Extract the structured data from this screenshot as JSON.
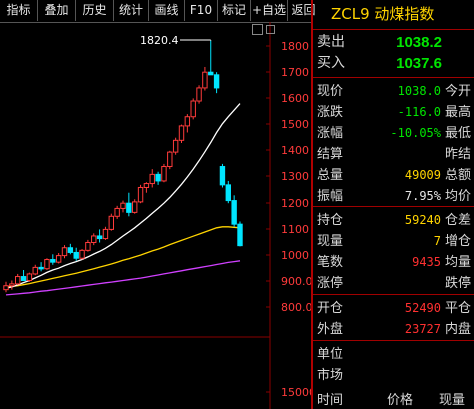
{
  "toolbar": {
    "items": [
      "指标",
      "叠加",
      "历史",
      "统计",
      "画线",
      "F10",
      "标记",
      "+自选",
      "返回"
    ]
  },
  "chart": {
    "peak_label": "1820.4",
    "y_ticks": [
      "1800",
      "1700",
      "1600",
      "1500",
      "1400",
      "1300",
      "1200",
      "1100",
      "1000",
      "900.0",
      "800.0",
      "15000"
    ],
    "colors": {
      "up": "#ff3b3b",
      "down": "#00e5ff",
      "ma_short": "#ffffff",
      "ma_mid": "#ffd400",
      "ma_long": "#d040ff",
      "axis_text": "#ff3b3b"
    },
    "candles": [
      [
        870,
        900,
        860,
        885
      ],
      [
        885,
        905,
        870,
        892
      ],
      [
        892,
        930,
        888,
        920
      ],
      [
        920,
        945,
        910,
        905
      ],
      [
        905,
        935,
        900,
        930
      ],
      [
        930,
        965,
        925,
        955
      ],
      [
        955,
        975,
        940,
        950
      ],
      [
        950,
        990,
        945,
        985
      ],
      [
        985,
        1005,
        965,
        975
      ],
      [
        975,
        1010,
        970,
        1000
      ],
      [
        1000,
        1040,
        990,
        1030
      ],
      [
        1030,
        1045,
        1005,
        1012
      ],
      [
        1012,
        1030,
        980,
        990
      ],
      [
        990,
        1025,
        985,
        1020
      ],
      [
        1020,
        1060,
        1015,
        1050
      ],
      [
        1050,
        1085,
        1040,
        1075
      ],
      [
        1075,
        1100,
        1050,
        1065
      ],
      [
        1065,
        1110,
        1060,
        1100
      ],
      [
        1100,
        1160,
        1095,
        1150
      ],
      [
        1150,
        1190,
        1140,
        1180
      ],
      [
        1180,
        1210,
        1165,
        1200
      ],
      [
        1200,
        1240,
        1150,
        1165
      ],
      [
        1165,
        1215,
        1160,
        1205
      ],
      [
        1205,
        1270,
        1200,
        1260
      ],
      [
        1260,
        1280,
        1240,
        1275
      ],
      [
        1275,
        1330,
        1260,
        1310
      ],
      [
        1310,
        1320,
        1270,
        1285
      ],
      [
        1285,
        1350,
        1280,
        1340
      ],
      [
        1340,
        1400,
        1330,
        1395
      ],
      [
        1395,
        1450,
        1385,
        1440
      ],
      [
        1440,
        1500,
        1430,
        1495
      ],
      [
        1495,
        1540,
        1470,
        1530
      ],
      [
        1530,
        1600,
        1520,
        1590
      ],
      [
        1590,
        1650,
        1580,
        1640
      ],
      [
        1640,
        1720,
        1630,
        1700
      ],
      [
        1700,
        1820.4,
        1690,
        1690
      ],
      [
        1690,
        1700,
        1620,
        1640
      ],
      [
        1340,
        1350,
        1260,
        1270
      ],
      [
        1270,
        1285,
        1200,
        1210
      ],
      [
        1210,
        1230,
        1110,
        1120
      ],
      [
        1120,
        1130,
        1035,
        1038
      ]
    ],
    "ma_short": [
      876,
      880,
      888,
      897,
      905,
      915,
      925,
      936,
      945,
      952,
      962,
      970,
      977,
      985,
      995,
      1006,
      1016,
      1028,
      1042,
      1058,
      1075,
      1090,
      1106,
      1124,
      1142,
      1162,
      1180,
      1200,
      1222,
      1246,
      1272,
      1300,
      1330,
      1362,
      1396,
      1432,
      1470,
      1503,
      1530,
      1555,
      1580
    ],
    "ma_mid": [
      880,
      882,
      885,
      889,
      893,
      898,
      903,
      908,
      913,
      918,
      923,
      928,
      933,
      938,
      944,
      950,
      956,
      962,
      968,
      975,
      982,
      988,
      995,
      1002,
      1010,
      1018,
      1025,
      1033,
      1042,
      1050,
      1058,
      1066,
      1074,
      1082,
      1090,
      1098,
      1106,
      1110,
      1110,
      1108,
      1106
    ],
    "ma_long": [
      850,
      852,
      854,
      856,
      858,
      861,
      864,
      866,
      869,
      872,
      875,
      878,
      881,
      884,
      887,
      890,
      893,
      896,
      899,
      902,
      905,
      908,
      911,
      914,
      918,
      922,
      926,
      930,
      934,
      938,
      942,
      946,
      950,
      954,
      958,
      962,
      966,
      970,
      974,
      977,
      980
    ]
  },
  "quote": {
    "title": "ZCL9 动煤指数",
    "sell_label": "卖出",
    "sell_value": "1038.2",
    "buy_label": "买入",
    "buy_value": "1037.6",
    "rows": [
      {
        "label": "现价",
        "value": "1038.0",
        "right": "今开",
        "color": "green"
      },
      {
        "label": "涨跌",
        "value": "-116.0",
        "right": "最高",
        "color": "green"
      },
      {
        "label": "涨幅",
        "value": "-10.05%",
        "right": "最低",
        "color": "green"
      },
      {
        "label": "结算",
        "value": "",
        "right": "昨结",
        "color": "white"
      },
      {
        "label": "总量",
        "value": "49009",
        "right": "总额",
        "color": "yellow"
      },
      {
        "label": "振幅",
        "value": "7.95%",
        "right": "均价",
        "color": "white"
      },
      {
        "label": "持仓",
        "value": "59240",
        "right": "仓差",
        "color": "yellow"
      },
      {
        "label": "现量",
        "value": "7",
        "right": "增仓",
        "color": "yellow"
      },
      {
        "label": "笔数",
        "value": "9435",
        "right": "均量",
        "color": "red"
      },
      {
        "label": "涨停",
        "value": "",
        "right": "跌停",
        "color": "white"
      },
      {
        "label": "开仓",
        "value": "52490",
        "right": "平仓",
        "color": "red"
      },
      {
        "label": "外盘",
        "value": "23727",
        "right": "内盘",
        "color": "red"
      },
      {
        "label": "单位",
        "value": "",
        "right": "",
        "color": "white"
      },
      {
        "label": "市场",
        "value": "",
        "right": "",
        "color": "white"
      }
    ],
    "footer": {
      "time": "时间",
      "price": "价格",
      "volume": "现量"
    }
  }
}
